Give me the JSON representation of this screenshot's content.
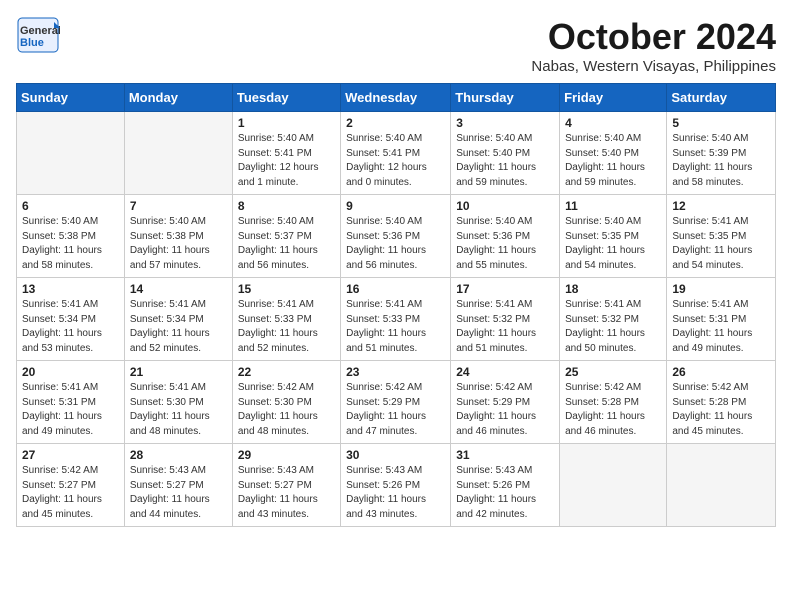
{
  "header": {
    "logo_line1": "General",
    "logo_line2": "Blue",
    "month": "October 2024",
    "location": "Nabas, Western Visayas, Philippines"
  },
  "weekdays": [
    "Sunday",
    "Monday",
    "Tuesday",
    "Wednesday",
    "Thursday",
    "Friday",
    "Saturday"
  ],
  "weeks": [
    [
      {
        "day": "",
        "empty": true
      },
      {
        "day": "",
        "empty": true
      },
      {
        "day": "1",
        "sunrise": "5:40 AM",
        "sunset": "5:41 PM",
        "daylight": "12 hours and 1 minute."
      },
      {
        "day": "2",
        "sunrise": "5:40 AM",
        "sunset": "5:41 PM",
        "daylight": "12 hours and 0 minutes."
      },
      {
        "day": "3",
        "sunrise": "5:40 AM",
        "sunset": "5:40 PM",
        "daylight": "11 hours and 59 minutes."
      },
      {
        "day": "4",
        "sunrise": "5:40 AM",
        "sunset": "5:40 PM",
        "daylight": "11 hours and 59 minutes."
      },
      {
        "day": "5",
        "sunrise": "5:40 AM",
        "sunset": "5:39 PM",
        "daylight": "11 hours and 58 minutes."
      }
    ],
    [
      {
        "day": "6",
        "sunrise": "5:40 AM",
        "sunset": "5:38 PM",
        "daylight": "11 hours and 58 minutes."
      },
      {
        "day": "7",
        "sunrise": "5:40 AM",
        "sunset": "5:38 PM",
        "daylight": "11 hours and 57 minutes."
      },
      {
        "day": "8",
        "sunrise": "5:40 AM",
        "sunset": "5:37 PM",
        "daylight": "11 hours and 56 minutes."
      },
      {
        "day": "9",
        "sunrise": "5:40 AM",
        "sunset": "5:36 PM",
        "daylight": "11 hours and 56 minutes."
      },
      {
        "day": "10",
        "sunrise": "5:40 AM",
        "sunset": "5:36 PM",
        "daylight": "11 hours and 55 minutes."
      },
      {
        "day": "11",
        "sunrise": "5:40 AM",
        "sunset": "5:35 PM",
        "daylight": "11 hours and 54 minutes."
      },
      {
        "day": "12",
        "sunrise": "5:41 AM",
        "sunset": "5:35 PM",
        "daylight": "11 hours and 54 minutes."
      }
    ],
    [
      {
        "day": "13",
        "sunrise": "5:41 AM",
        "sunset": "5:34 PM",
        "daylight": "11 hours and 53 minutes."
      },
      {
        "day": "14",
        "sunrise": "5:41 AM",
        "sunset": "5:34 PM",
        "daylight": "11 hours and 52 minutes."
      },
      {
        "day": "15",
        "sunrise": "5:41 AM",
        "sunset": "5:33 PM",
        "daylight": "11 hours and 52 minutes."
      },
      {
        "day": "16",
        "sunrise": "5:41 AM",
        "sunset": "5:33 PM",
        "daylight": "11 hours and 51 minutes."
      },
      {
        "day": "17",
        "sunrise": "5:41 AM",
        "sunset": "5:32 PM",
        "daylight": "11 hours and 51 minutes."
      },
      {
        "day": "18",
        "sunrise": "5:41 AM",
        "sunset": "5:32 PM",
        "daylight": "11 hours and 50 minutes."
      },
      {
        "day": "19",
        "sunrise": "5:41 AM",
        "sunset": "5:31 PM",
        "daylight": "11 hours and 49 minutes."
      }
    ],
    [
      {
        "day": "20",
        "sunrise": "5:41 AM",
        "sunset": "5:31 PM",
        "daylight": "11 hours and 49 minutes."
      },
      {
        "day": "21",
        "sunrise": "5:41 AM",
        "sunset": "5:30 PM",
        "daylight": "11 hours and 48 minutes."
      },
      {
        "day": "22",
        "sunrise": "5:42 AM",
        "sunset": "5:30 PM",
        "daylight": "11 hours and 48 minutes."
      },
      {
        "day": "23",
        "sunrise": "5:42 AM",
        "sunset": "5:29 PM",
        "daylight": "11 hours and 47 minutes."
      },
      {
        "day": "24",
        "sunrise": "5:42 AM",
        "sunset": "5:29 PM",
        "daylight": "11 hours and 46 minutes."
      },
      {
        "day": "25",
        "sunrise": "5:42 AM",
        "sunset": "5:28 PM",
        "daylight": "11 hours and 46 minutes."
      },
      {
        "day": "26",
        "sunrise": "5:42 AM",
        "sunset": "5:28 PM",
        "daylight": "11 hours and 45 minutes."
      }
    ],
    [
      {
        "day": "27",
        "sunrise": "5:42 AM",
        "sunset": "5:27 PM",
        "daylight": "11 hours and 45 minutes."
      },
      {
        "day": "28",
        "sunrise": "5:43 AM",
        "sunset": "5:27 PM",
        "daylight": "11 hours and 44 minutes."
      },
      {
        "day": "29",
        "sunrise": "5:43 AM",
        "sunset": "5:27 PM",
        "daylight": "11 hours and 43 minutes."
      },
      {
        "day": "30",
        "sunrise": "5:43 AM",
        "sunset": "5:26 PM",
        "daylight": "11 hours and 43 minutes."
      },
      {
        "day": "31",
        "sunrise": "5:43 AM",
        "sunset": "5:26 PM",
        "daylight": "11 hours and 42 minutes."
      },
      {
        "day": "",
        "empty": true
      },
      {
        "day": "",
        "empty": true
      }
    ]
  ]
}
